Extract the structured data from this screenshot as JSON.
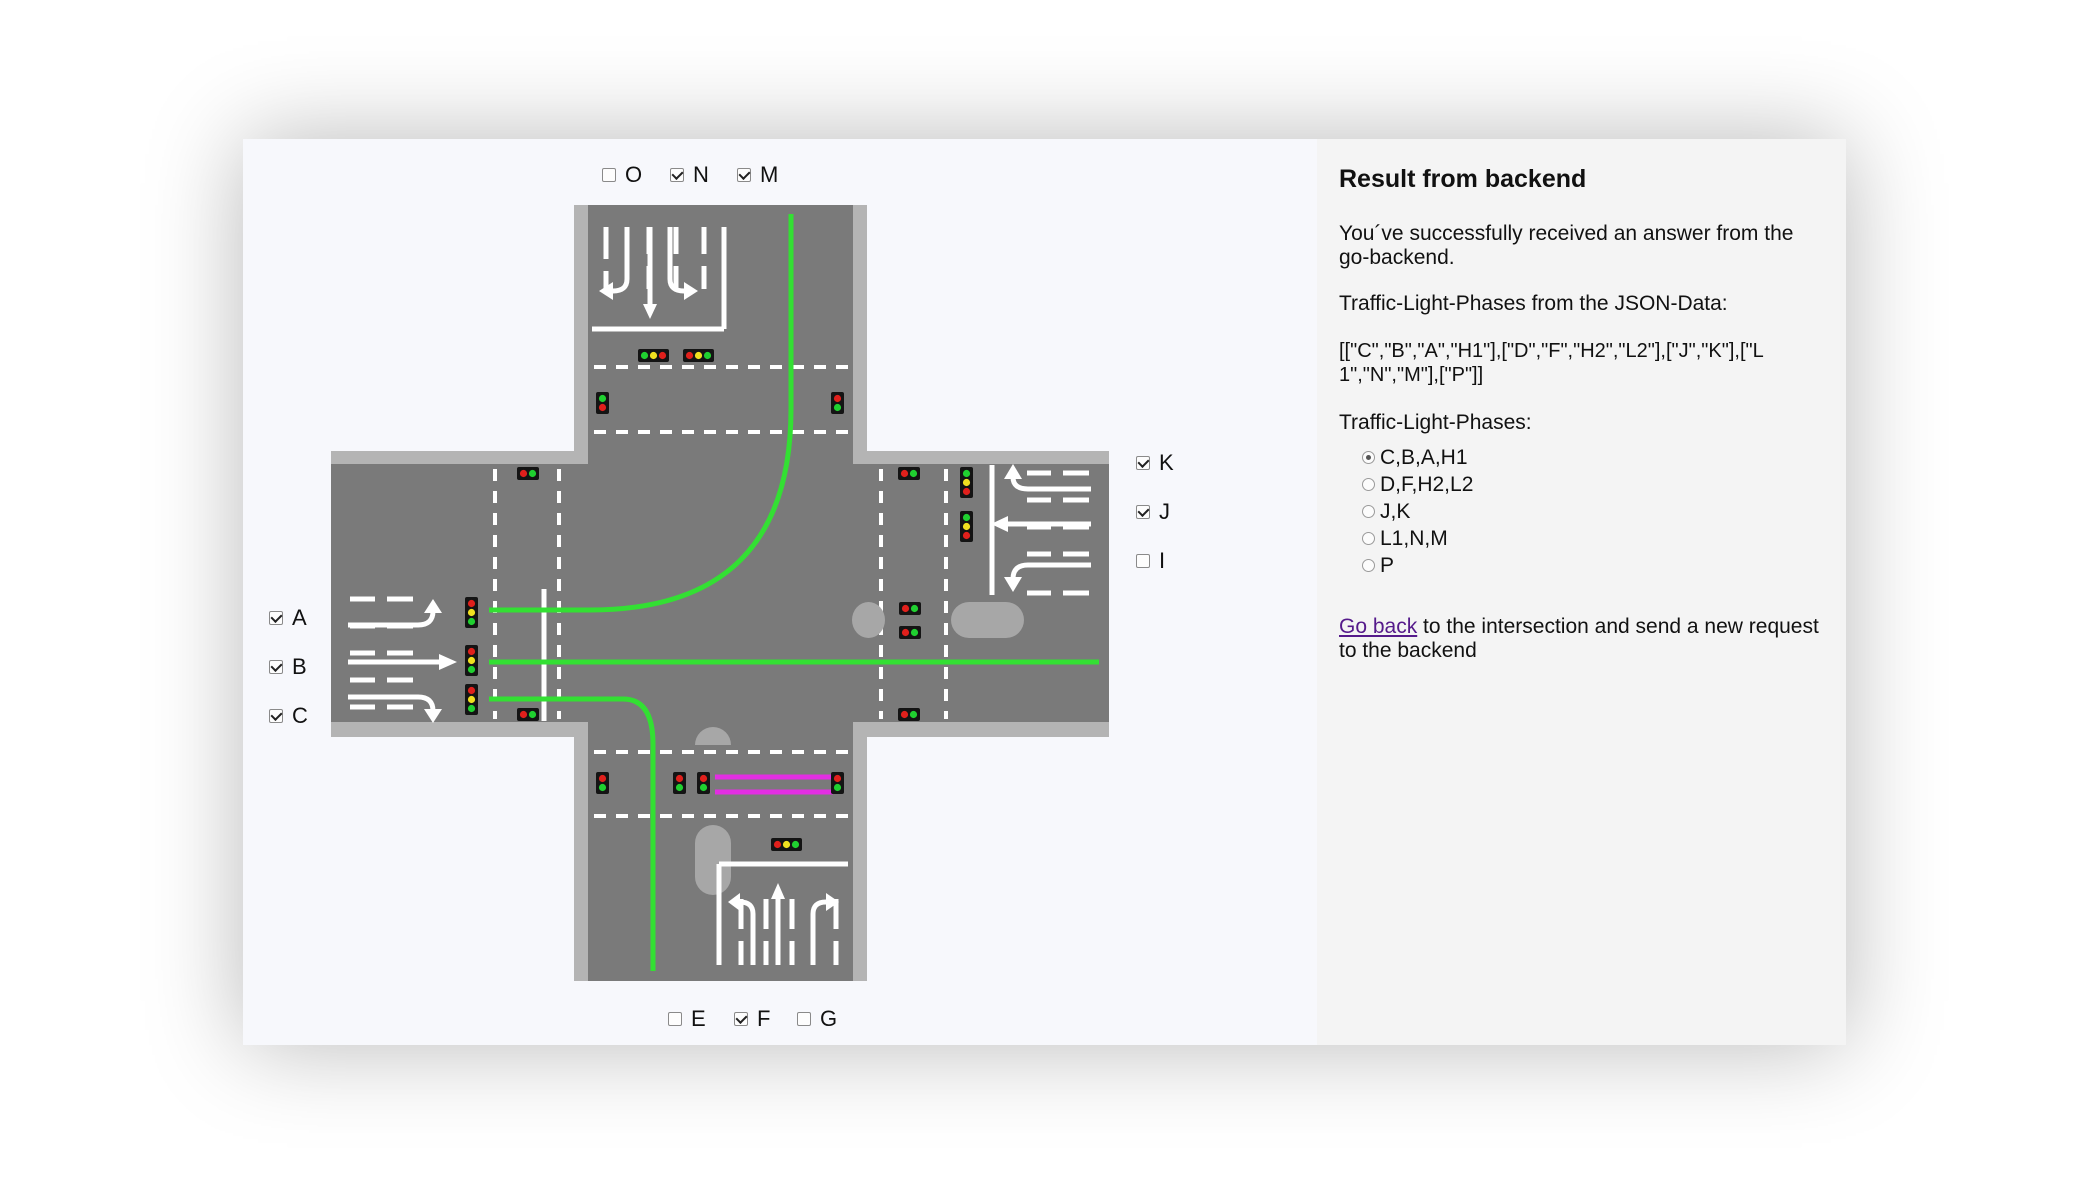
{
  "signals": {
    "top": [
      {
        "label": "O",
        "checked": false
      },
      {
        "label": "N",
        "checked": true
      },
      {
        "label": "M",
        "checked": true
      }
    ],
    "right": [
      {
        "label": "K",
        "checked": true
      },
      {
        "label": "J",
        "checked": true
      },
      {
        "label": "I",
        "checked": false
      }
    ],
    "left": [
      {
        "label": "A",
        "checked": true
      },
      {
        "label": "B",
        "checked": true
      },
      {
        "label": "C",
        "checked": true
      }
    ],
    "bottom": [
      {
        "label": "E",
        "checked": false
      },
      {
        "label": "F",
        "checked": true
      },
      {
        "label": "G",
        "checked": false
      }
    ]
  },
  "colors": {
    "road": "#7a7a7a",
    "curb": "#b4b4b4",
    "active_route": "#33e033",
    "pedestrian_route": "#e22ee2",
    "light_red": "#e0201c",
    "light_yellow": "#f0e020",
    "light_green": "#20d030"
  },
  "result": {
    "title": "Result from backend",
    "message": "You´ve successfully received an answer from the go-backend.",
    "json_label": "Traffic-Light-Phases from the JSON-Data:",
    "json_value": "[[\"C\",\"B\",\"A\",\"H1\"],[\"D\",\"F\",\"H2\",\"L2\"],[\"J\",\"K\"],[\"L1\",\"N\",\"M\"],[\"P\"]]",
    "phases_label": "Traffic-Light-Phases:",
    "phases": [
      {
        "label": "C,B,A,H1",
        "selected": true
      },
      {
        "label": "D,F,H2,L2",
        "selected": false
      },
      {
        "label": "J,K",
        "selected": false
      },
      {
        "label": "L1,N,M",
        "selected": false
      },
      {
        "label": "P",
        "selected": false
      }
    ],
    "back_link": "Go back",
    "back_text": " to the intersection and send a new request to the backend"
  }
}
